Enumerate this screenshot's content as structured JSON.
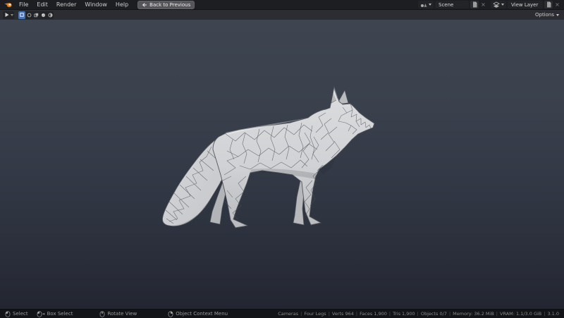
{
  "topbar": {
    "menus": [
      "File",
      "Edit",
      "Render",
      "Window",
      "Help"
    ],
    "back_button_label": "Back to Previous",
    "scene_selector": {
      "value": "Scene"
    },
    "view_layer_selector": {
      "value": "View Layer"
    }
  },
  "viewport_header": {
    "options_label": "Options"
  },
  "viewport": {
    "content": "low-poly fox 3D model in solid shading with wireframe"
  },
  "statusbar": {
    "hints": [
      {
        "icon": "mouse-left-click-icon",
        "label": "Select"
      },
      {
        "icon": "mouse-left-drag-icon",
        "label": "Box Select"
      },
      {
        "icon": "mouse-middle-drag-icon",
        "label": "Rotate View"
      },
      {
        "icon": "mouse-right-click-icon",
        "label": "Object Context Menu"
      }
    ],
    "stats": [
      "Cameras",
      "Four Legs",
      "Verts 964",
      "Faces 1,900",
      "Tris 1,900",
      "Objects 0/7",
      "Memory: 36.2 MiB",
      "VRAM: 1.1/3.0 GiB",
      "3.1.0"
    ]
  },
  "colors": {
    "accent_blue": "#4772b3",
    "logo_orange": "#e87d0d",
    "topbar_bg": "#1d1e22",
    "header_bg": "#2b2d33",
    "statusbar_bg": "#131417",
    "viewport_top": "#3e4551",
    "viewport_bottom": "#232631",
    "model_fill": "#d2d4d6",
    "wireframe": "#4b4f55"
  }
}
